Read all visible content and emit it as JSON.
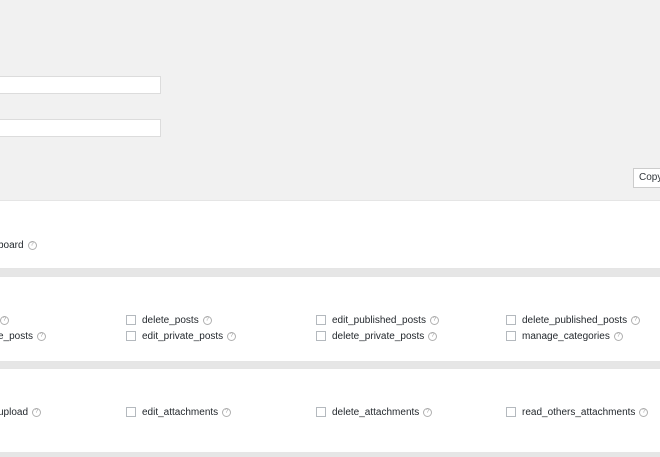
{
  "copy_button": {
    "label": "Copy"
  },
  "help_glyph": "?",
  "sections": {
    "general": {
      "items": [
        {
          "label": "board"
        }
      ]
    },
    "posts": {
      "row1": [
        {
          "label": ""
        },
        {
          "label": "delete_posts"
        },
        {
          "label": "edit_published_posts"
        },
        {
          "label": "delete_published_posts"
        }
      ],
      "row2": [
        {
          "label": "e_posts"
        },
        {
          "label": "edit_private_posts"
        },
        {
          "label": "delete_private_posts"
        },
        {
          "label": "manage_categories"
        }
      ]
    },
    "media": {
      "row1": [
        {
          "label": "upload"
        },
        {
          "label": "edit_attachments"
        },
        {
          "label": "delete_attachments"
        },
        {
          "label": "read_others_attachments"
        }
      ]
    }
  }
}
